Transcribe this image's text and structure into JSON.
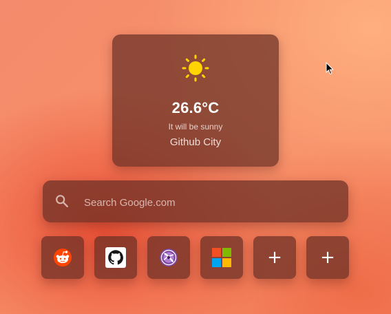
{
  "weather": {
    "icon": "sun-icon",
    "temperature": "26.6°C",
    "description": "It will be sunny",
    "city": "Github City",
    "icon_color": "#ffd400"
  },
  "search": {
    "icon": "search-icon",
    "placeholder": "Search Google.com"
  },
  "shortcuts": [
    {
      "name": "reddit",
      "icon": "reddit-icon"
    },
    {
      "name": "github",
      "icon": "github-icon"
    },
    {
      "name": "tor-browser",
      "icon": "tor-browser-icon"
    },
    {
      "name": "microsoft",
      "icon": "microsoft-icon"
    },
    {
      "name": "add",
      "icon": "plus-icon",
      "label": "+"
    },
    {
      "name": "add",
      "icon": "plus-icon",
      "label": "+"
    }
  ],
  "colors": {
    "card_background": "rgba(104,46,36,0.72)",
    "reddit": "#ff4500",
    "microsoft": [
      "#f25022",
      "#7fba00",
      "#00a4ef",
      "#ffb900"
    ]
  }
}
